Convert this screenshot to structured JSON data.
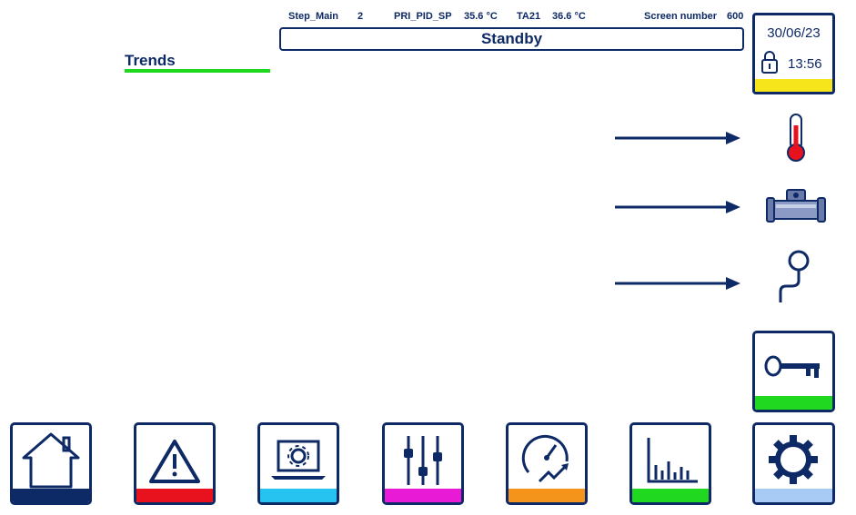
{
  "header": {
    "step_label": "Step_Main",
    "step_value": "2",
    "setpoint_label": "PRI_PID_SP",
    "setpoint_value": "35.6 °C",
    "ta21_label": "TA21",
    "ta21_value": "36.6 °C",
    "screen_label": "Screen number",
    "screen_value": "600",
    "status": "Standby"
  },
  "page": {
    "title": "Trends"
  },
  "clock": {
    "date": "30/06/23",
    "time": "13:56"
  },
  "sensors": [
    {
      "icon": "thermometer-icon"
    },
    {
      "icon": "flowmeter-icon"
    },
    {
      "icon": "pressure-gauge-icon"
    }
  ],
  "colors": {
    "primary": "#0e2a66",
    "home": "#0e2a66",
    "alarms": "#e8121f",
    "system": "#27c3f0",
    "settings": "#e81ad6",
    "performance": "#f5941a",
    "trends": "#1fd81f",
    "config": "#a7cbf5",
    "clock_bar": "#f5e51a",
    "access_bar": "#1fd81f",
    "title_underline": "#1fd81f",
    "thermometer_red": "#e8121f"
  },
  "nav": [
    {
      "id": "home",
      "icon": "home-icon"
    },
    {
      "id": "alarms",
      "icon": "warning-icon"
    },
    {
      "id": "system",
      "icon": "laptop-gear-icon"
    },
    {
      "id": "settings",
      "icon": "sliders-icon"
    },
    {
      "id": "performance",
      "icon": "speedometer-icon"
    },
    {
      "id": "trends",
      "icon": "bar-chart-icon"
    },
    {
      "id": "config",
      "icon": "gear-icon"
    }
  ],
  "access": {
    "icon": "key-icon"
  }
}
